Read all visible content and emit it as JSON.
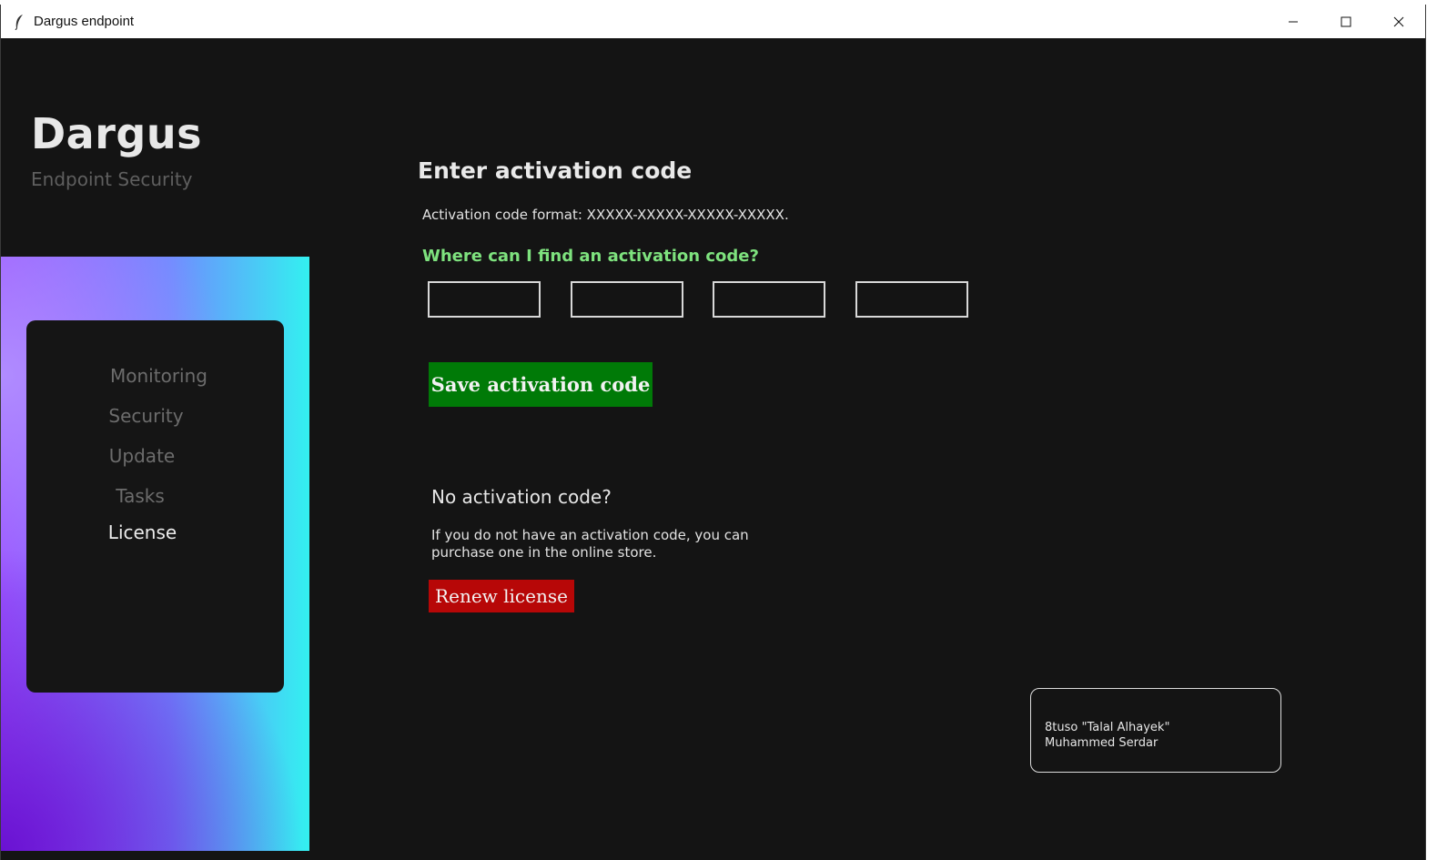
{
  "window": {
    "title": "Dargus endpoint",
    "app_icon": "feather-icon",
    "controls": [
      "minimize-icon",
      "maximize-icon",
      "close-icon"
    ]
  },
  "brand": {
    "title": "Dargus",
    "subtitle": "Endpoint Security"
  },
  "sidebar": {
    "items": [
      {
        "label": "Monitoring",
        "active": false
      },
      {
        "label": "Security",
        "active": false
      },
      {
        "label": "Update",
        "active": false
      },
      {
        "label": "Tasks",
        "active": false
      },
      {
        "label": "License",
        "active": true
      }
    ]
  },
  "activation": {
    "heading": "Enter activation code",
    "format_text": "Activation code format: XXXXX-XXXXX-XXXXX-XXXXX.",
    "help_link": "Where can I find an activation code?",
    "inputs": [
      {
        "value": ""
      },
      {
        "value": ""
      },
      {
        "value": ""
      },
      {
        "value": ""
      }
    ],
    "save_label": "Save activation code"
  },
  "no_activation": {
    "heading": "No activation code?",
    "text": "If you do not have an activation code, you can purchase one in the online store.",
    "renew_label": "Renew license"
  },
  "credits": {
    "line1": "8tuso \"Talal Alhayek\"",
    "line2": "Muhammed Serdar"
  },
  "colors": {
    "background": "#141414",
    "save_button": "#007a07",
    "renew_button": "#b70707",
    "help_link": "#7ee27e"
  }
}
